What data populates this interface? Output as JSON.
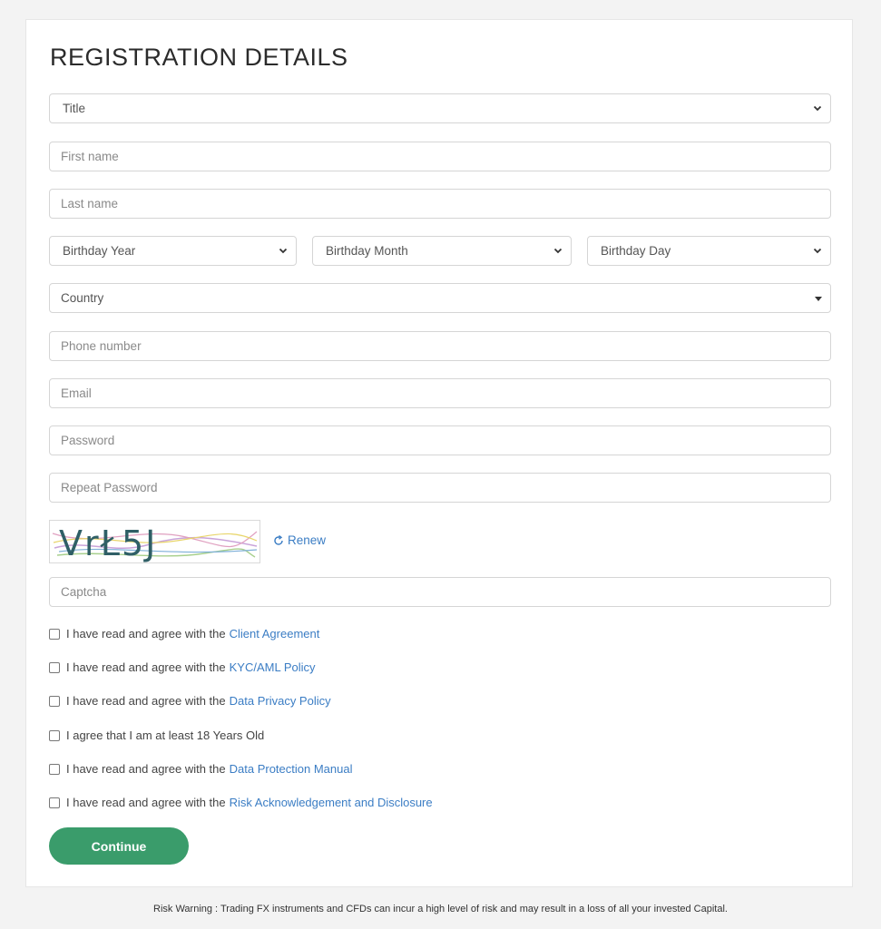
{
  "form": {
    "heading": "REGISTRATION DETAILS",
    "title_select": "Title",
    "first_name_placeholder": "First name",
    "last_name_placeholder": "Last name",
    "birthday_year": "Birthday Year",
    "birthday_month": "Birthday Month",
    "birthday_day": "Birthday Day",
    "country": "Country",
    "phone_placeholder": "Phone number",
    "email_placeholder": "Email",
    "password_placeholder": "Password",
    "repeat_password_placeholder": "Repeat Password",
    "captcha_text": "VrŁ5J",
    "renew_label": "Renew",
    "captcha_placeholder": "Captcha",
    "continue_label": "Continue"
  },
  "agreements": [
    {
      "text": "I have read and agree with the",
      "link": "Client Agreement"
    },
    {
      "text": "I have read and agree with the",
      "link": "KYC/AML Policy"
    },
    {
      "text": "I have read and agree with the",
      "link": "Data Privacy Policy"
    },
    {
      "text": "I agree that I am at least 18 Years Old",
      "link": ""
    },
    {
      "text": "I have read and agree with the",
      "link": "Data Protection Manual"
    },
    {
      "text": "I have read and agree with the",
      "link": "Risk Acknowledgement and Disclosure"
    }
  ],
  "footer": {
    "risk_warning": "Risk Warning : Trading FX instruments and CFDs can incur a high level of risk and may result in a loss of all your invested Capital."
  },
  "colors": {
    "accent_green": "#3a9c6b",
    "link_blue": "#3b7dc4"
  },
  "icons": {
    "select": "chevron-down-icon",
    "country": "caret-down-icon",
    "renew": "refresh-icon"
  }
}
